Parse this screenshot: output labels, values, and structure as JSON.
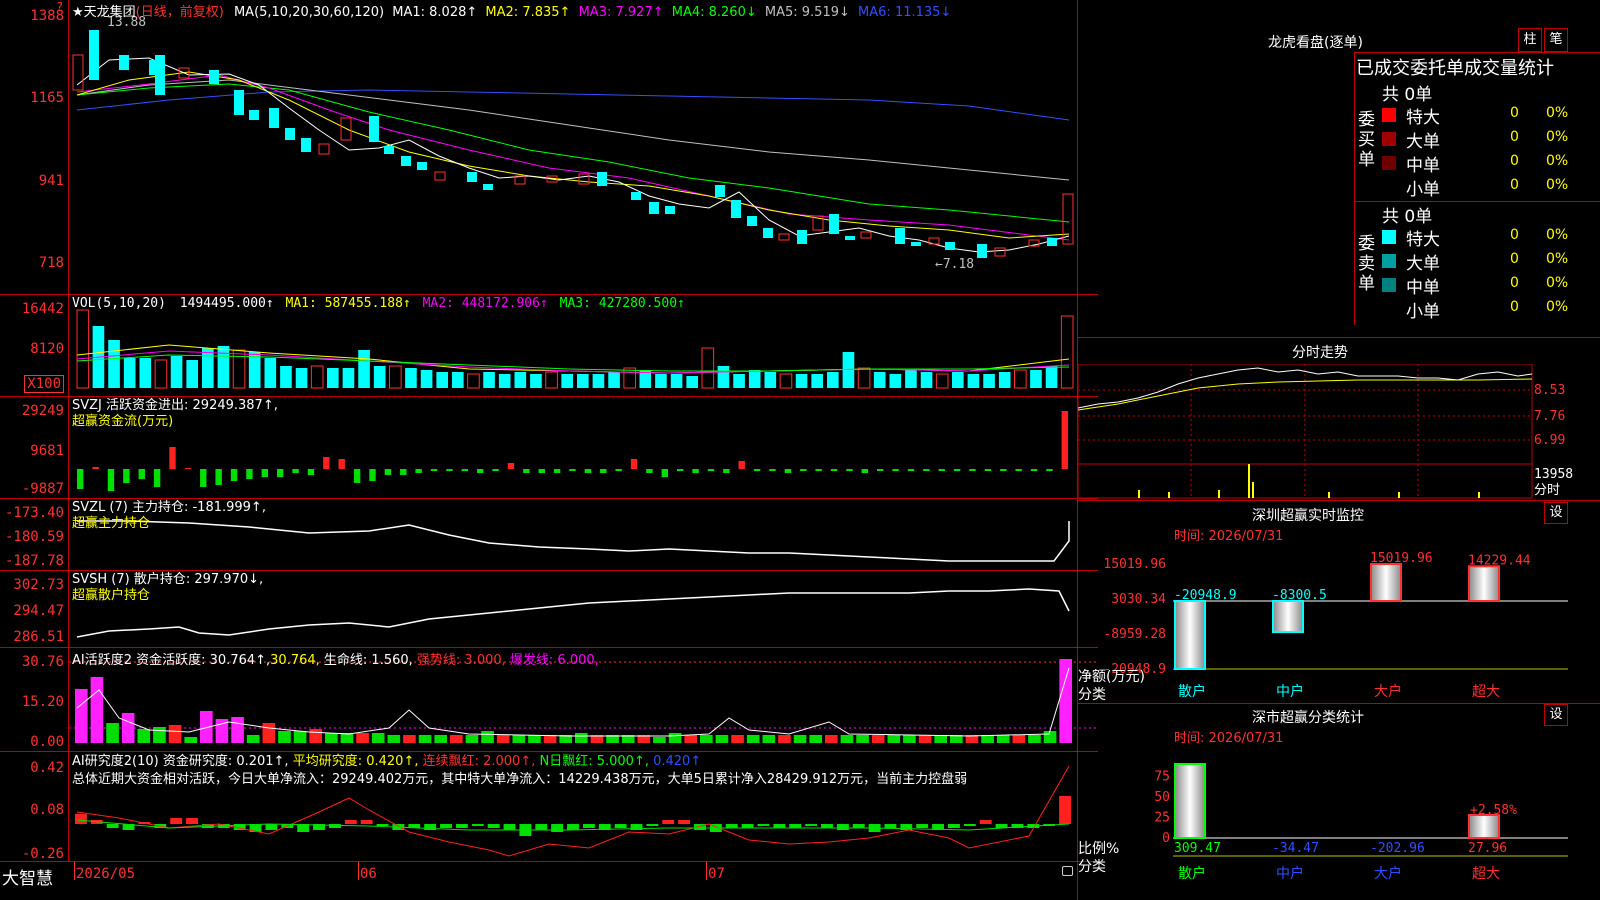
{
  "header": {
    "stock": "★天龙集团",
    "period": "(日线，前复权)",
    "ma_label": "MA(5,10,20,30,60,120)",
    "ma_values": [
      {
        "text": "MA1: 8.028↑",
        "color": "#ffffff"
      },
      {
        "text": "MA2: 7.835↑",
        "color": "#ffff00"
      },
      {
        "text": "MA3: 7.927↑",
        "color": "#ff00ff"
      },
      {
        "text": "MA4: 8.260↓",
        "color": "#00ff00"
      },
      {
        "text": "MA5: 9.519↓",
        "color": "#c0c0c0"
      },
      {
        "text": "MA6: 11.135↓",
        "color": "#3050ff"
      }
    ]
  },
  "kline": {
    "y_labels": [
      "1388",
      "1165",
      "941",
      "718"
    ],
    "high_marker": "13.88",
    "low_marker": "←7.18"
  },
  "vol": {
    "title": "VOL(5,10,20)",
    "items": [
      {
        "text": "1494495.000↑",
        "color": "#ffffff"
      },
      {
        "text": "MA1: 587455.188↑",
        "color": "#ffff00"
      },
      {
        "text": "MA2: 448172.906↑",
        "color": "#ff00ff"
      },
      {
        "text": "MA3: 427280.500↑",
        "color": "#00ff00"
      }
    ],
    "y_labels": [
      "16442",
      "8120",
      "X100"
    ]
  },
  "svzj": {
    "line1": "SVZJ  活跃资金进出: 29249.387↑,",
    "line2": "超赢资金流(万元)",
    "y_labels": [
      "29249",
      "9681",
      "-9887"
    ]
  },
  "svzl": {
    "line1": "SVZL (7) 主力持仓: -181.999↑,",
    "line2": "超赢主力持仓",
    "y_labels": [
      "-173.40",
      "-180.59",
      "-187.78"
    ]
  },
  "svsh": {
    "line1": "SVSH (7) 散户持仓: 297.970↓,",
    "line2": "超赢散户持仓",
    "y_labels": [
      "302.73",
      "294.47",
      "286.51"
    ]
  },
  "ai_active": {
    "items": [
      {
        "text": "AI活跃度2 资金活跃度: 30.764↑,",
        "color": "#ffffff"
      },
      {
        "text": "30.764,",
        "color": "#ffff00"
      },
      {
        "text": " 生命线: 1.560,",
        "color": "#ffffff"
      },
      {
        "text": " 强势线: 3.000,",
        "color": "#ff3030"
      },
      {
        "text": " 爆发线: 6.000,",
        "color": "#ff00ff"
      }
    ],
    "y_labels": [
      "30.76",
      "15.20",
      "0.00"
    ]
  },
  "ai_research": {
    "items": [
      {
        "text": "AI研究度2(10) 资金研究度: 0.201↑,",
        "color": "#ffffff"
      },
      {
        "text": " 平均研究度: 0.420↑,",
        "color": "#ffff00"
      },
      {
        "text": " 连续飘红: 2.000↑,",
        "color": "#ff3030"
      },
      {
        "text": " N日飘红: 5.000↑,",
        "color": "#00ff00"
      },
      {
        "text": " 0.420↑",
        "color": "#3050ff"
      }
    ],
    "summary": "总体近期大资金相对活跃，今日大单净流入：29249.402万元，其中特大单净流入：14229.438万元，大单5日累计净入28429.912万元，当前主力控盘弱",
    "y_labels": [
      "0.42",
      "0.08",
      "-0.26"
    ]
  },
  "date_axis": {
    "brand": "大智慧",
    "labels": [
      "2026/05",
      "06",
      "07"
    ]
  },
  "right_panel": {
    "toggle_buttons": [
      "柱",
      "笔"
    ],
    "lhb_title": "龙虎看盘(逐单)",
    "stats_header": "已成交委托单成交量统计",
    "buy": {
      "side_label": "委买单",
      "total": "共 0单",
      "rows": [
        {
          "label": "特大",
          "count": "0",
          "pct": "0%",
          "color": "#ff0000"
        },
        {
          "label": "大单",
          "count": "0",
          "pct": "0%",
          "color": "#a00000"
        },
        {
          "label": "中单",
          "count": "0",
          "pct": "0%",
          "color": "#700000"
        },
        {
          "label": "小单",
          "count": "0",
          "pct": "0%",
          "color": "#000000"
        }
      ]
    },
    "sell": {
      "side_label": "委卖单",
      "total": "共 0单",
      "rows": [
        {
          "label": "特大",
          "count": "0",
          "pct": "0%",
          "color": "#00ffff"
        },
        {
          "label": "大单",
          "count": "0",
          "pct": "0%",
          "color": "#00a0a0"
        },
        {
          "label": "中单",
          "count": "0",
          "pct": "0%",
          "color": "#008080"
        },
        {
          "label": "小单",
          "count": "0",
          "pct": "0%",
          "color": "#000000"
        }
      ]
    },
    "intraday": {
      "title": "分时走势",
      "y_labels": [
        "8.53",
        "7.76",
        "6.99",
        "13958"
      ],
      "bottom_label": "分时"
    },
    "sz_monitor": {
      "title": "深圳超赢实时监控",
      "settings": "设",
      "time": "时间: 2026/07/31",
      "y_labels": [
        "15019.96",
        "3030.34",
        "-8959.28",
        "-20948.9"
      ],
      "axis_name": "净额(万元)",
      "axis_name2": "分类",
      "categories": [
        "散户",
        "中户",
        "大户",
        "超大"
      ],
      "values": [
        -20948.9,
        -8300.5,
        15019.96,
        14229.44
      ],
      "value_labels": [
        "-20948.9",
        "-8300.5",
        "15019.96",
        "14229.44"
      ]
    },
    "sz_stats": {
      "title": "深市超赢分类统计",
      "settings": "设",
      "time": "时间: 2026/07/31",
      "y_labels": [
        "75",
        "50",
        "25",
        "0"
      ],
      "axis_name": "比例%",
      "axis_name2": "分类",
      "categories": [
        "散户",
        "中户",
        "大户",
        "超大"
      ],
      "values": [
        309.47,
        -34.47,
        -202.96,
        27.96
      ],
      "value_labels": [
        "309.47",
        "-34.47",
        "-202.96",
        "27.96"
      ],
      "extra_label": "+2.58%"
    }
  }
}
